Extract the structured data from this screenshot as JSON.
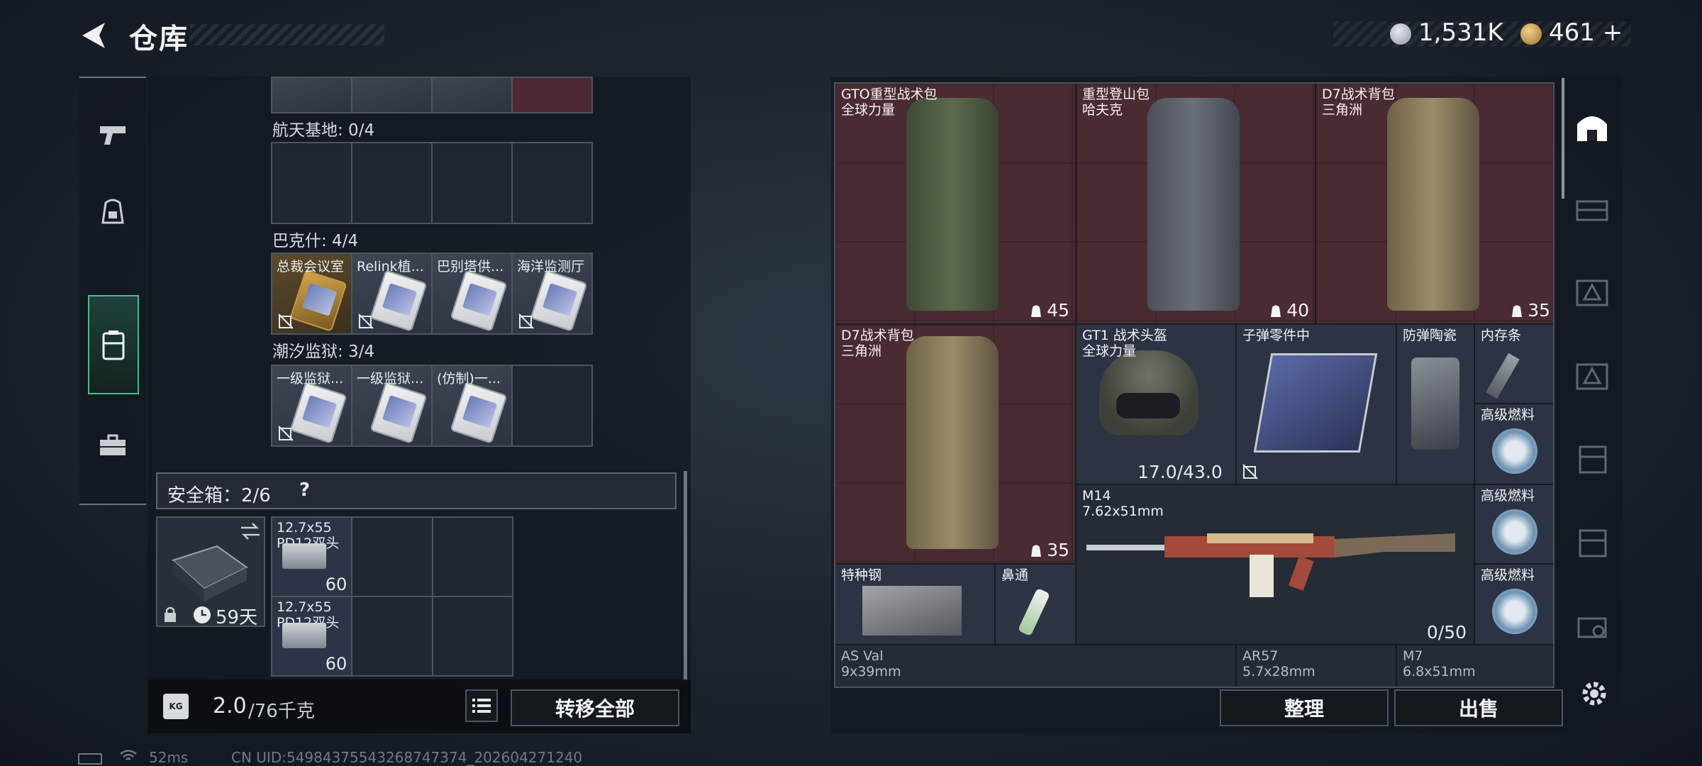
{
  "header": {
    "title": "仓库",
    "currency_silver": "1,531K",
    "currency_gold": "461 +"
  },
  "left_rail": {
    "items": [
      {
        "name": "weapon",
        "icon": "pistol-icon"
      },
      {
        "name": "gear",
        "icon": "backpack-icon"
      },
      {
        "name": "storage",
        "icon": "case-icon",
        "active": true
      },
      {
        "name": "tools",
        "icon": "toolbox-icon"
      }
    ]
  },
  "collection": {
    "sections": [
      {
        "label": "航天基地: 0/4",
        "items": []
      },
      {
        "label": "巴克什: 4/4",
        "items": [
          {
            "name": "总裁会议室",
            "style": "gold"
          },
          {
            "name": "Relink植...",
            "style": "grey"
          },
          {
            "name": "巴别塔供...",
            "style": "grey"
          },
          {
            "name": "海洋监测厅",
            "style": "grey"
          }
        ]
      },
      {
        "label": "潮汐监狱: 3/4",
        "items": [
          {
            "name": "一级监狱...",
            "style": "grey"
          },
          {
            "name": "一级监狱...",
            "style": "grey"
          },
          {
            "name": "(仿制)一...",
            "style": "grey"
          }
        ]
      }
    ]
  },
  "safe_box": {
    "label": "安全箱：2/6",
    "help": "?",
    "days": "59天",
    "items": [
      {
        "name": "12.7x55",
        "name2": "PD12双头",
        "count": "60"
      },
      {
        "name": "12.7x55",
        "name2": "PD12双头",
        "count": "60"
      }
    ]
  },
  "weight": {
    "value": "2.0",
    "max": "/76千克",
    "transfer_all": "转移全部",
    "kg_badge": "KG"
  },
  "inventory": {
    "backpacks": [
      {
        "name": "GTO重型战术包",
        "sub": "全球力量",
        "cap": "45"
      },
      {
        "name": "重型登山包",
        "sub": "哈夫克",
        "cap": "40"
      },
      {
        "name": "D7战术背包",
        "sub": "三角洲",
        "cap": "35"
      },
      {
        "name": "D7战术背包",
        "sub": "三角洲",
        "cap": "35"
      }
    ],
    "helmet": {
      "name": "GT1 战术头盔",
      "sub": "全球力量",
      "durability": "17.0/43.0"
    },
    "bullet_parts": "子弹零件中",
    "ceramic": "防弹陶瓷",
    "memory": "内存条",
    "fuel_label": "高级燃料",
    "rifle": {
      "name": "M14",
      "caliber": "7.62x51mm",
      "ammo": "0/50"
    },
    "steel": "特种钢",
    "nasal": "鼻通",
    "bottom": [
      {
        "name": "AS Val",
        "caliber": "9x39mm"
      },
      {
        "name": "AR57",
        "caliber": "5.7x28mm"
      },
      {
        "name": "M7",
        "caliber": "6.8x51mm"
      }
    ]
  },
  "actions": {
    "sort": "整理",
    "sell": "出售"
  },
  "footer": {
    "ping": "52ms",
    "uid": "CN UID:54984375543268747374_202604271240"
  },
  "colors": {
    "accent": "#3fbf8f",
    "red_slot": "#4a2b32",
    "blue_slot": "#2c3343"
  }
}
